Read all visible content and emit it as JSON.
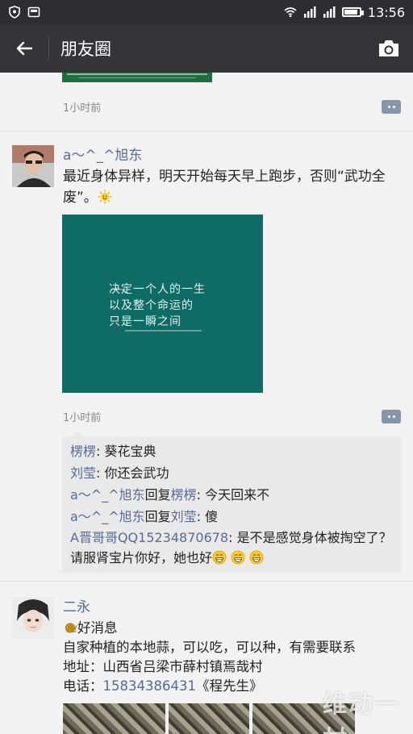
{
  "status_bar": {
    "time": "13:56",
    "battery_level": 0.9,
    "icons": [
      "shield-icon",
      "image-icon",
      "wifi-icon",
      "signal-icon",
      "signal-icon",
      "battery-icon"
    ]
  },
  "nav": {
    "back_icon": "arrow-left-icon",
    "title": "朋友圈",
    "camera_icon": "camera-icon"
  },
  "colors": {
    "nav_bg": "#353538",
    "status_bg": "#2e2e30",
    "name_blue": "#576b95",
    "post_image_bg": "#0f6b66"
  },
  "prev_post": {
    "time": "1小时前"
  },
  "post1": {
    "name": "a～^_^旭东",
    "text": "最近身体异样，明天开始每天早上跑步，否则“武功全废”。",
    "emoji": "sun-emoji",
    "image_lines": [
      "决定一个人的一生",
      "以及整个命运的",
      "只是一瞬之间"
    ],
    "time": "1小时前",
    "comments": [
      {
        "name": "楞楞",
        "sep": ": ",
        "text": "葵花宝典"
      },
      {
        "name": "刘莹",
        "sep": ": ",
        "text": "你还会武功"
      },
      {
        "name": "a～^_^旭东",
        "reply_word": "回复",
        "reply_to": "楞楞",
        "sep": ": ",
        "text": "今天回来不"
      },
      {
        "name": "a～^_^旭东",
        "reply_word": "回复",
        "reply_to": "刘莹",
        "sep": ": ",
        "text": "傻"
      },
      {
        "name": "A晋哥哥QQ15234870678",
        "sep": ": ",
        "text": "是不是感觉身体被掏空了？请服肾宝片你好，她也好",
        "emojis": [
          "grin-emoji",
          "grin-emoji",
          "grin-emoji"
        ]
      }
    ]
  },
  "post2": {
    "name": "二永",
    "line1_emoji": "snail-emoji",
    "line1": "好消息",
    "line2": "自家种植的本地蒜，可以吃，可以种，有需要联系",
    "line3": "地址：山西省吕梁市薛村镇焉哉村",
    "line4_prefix": "电话：",
    "phone": "15834386431",
    "line4_suffix": "《程先生》"
  },
  "watermark": "维动一村"
}
